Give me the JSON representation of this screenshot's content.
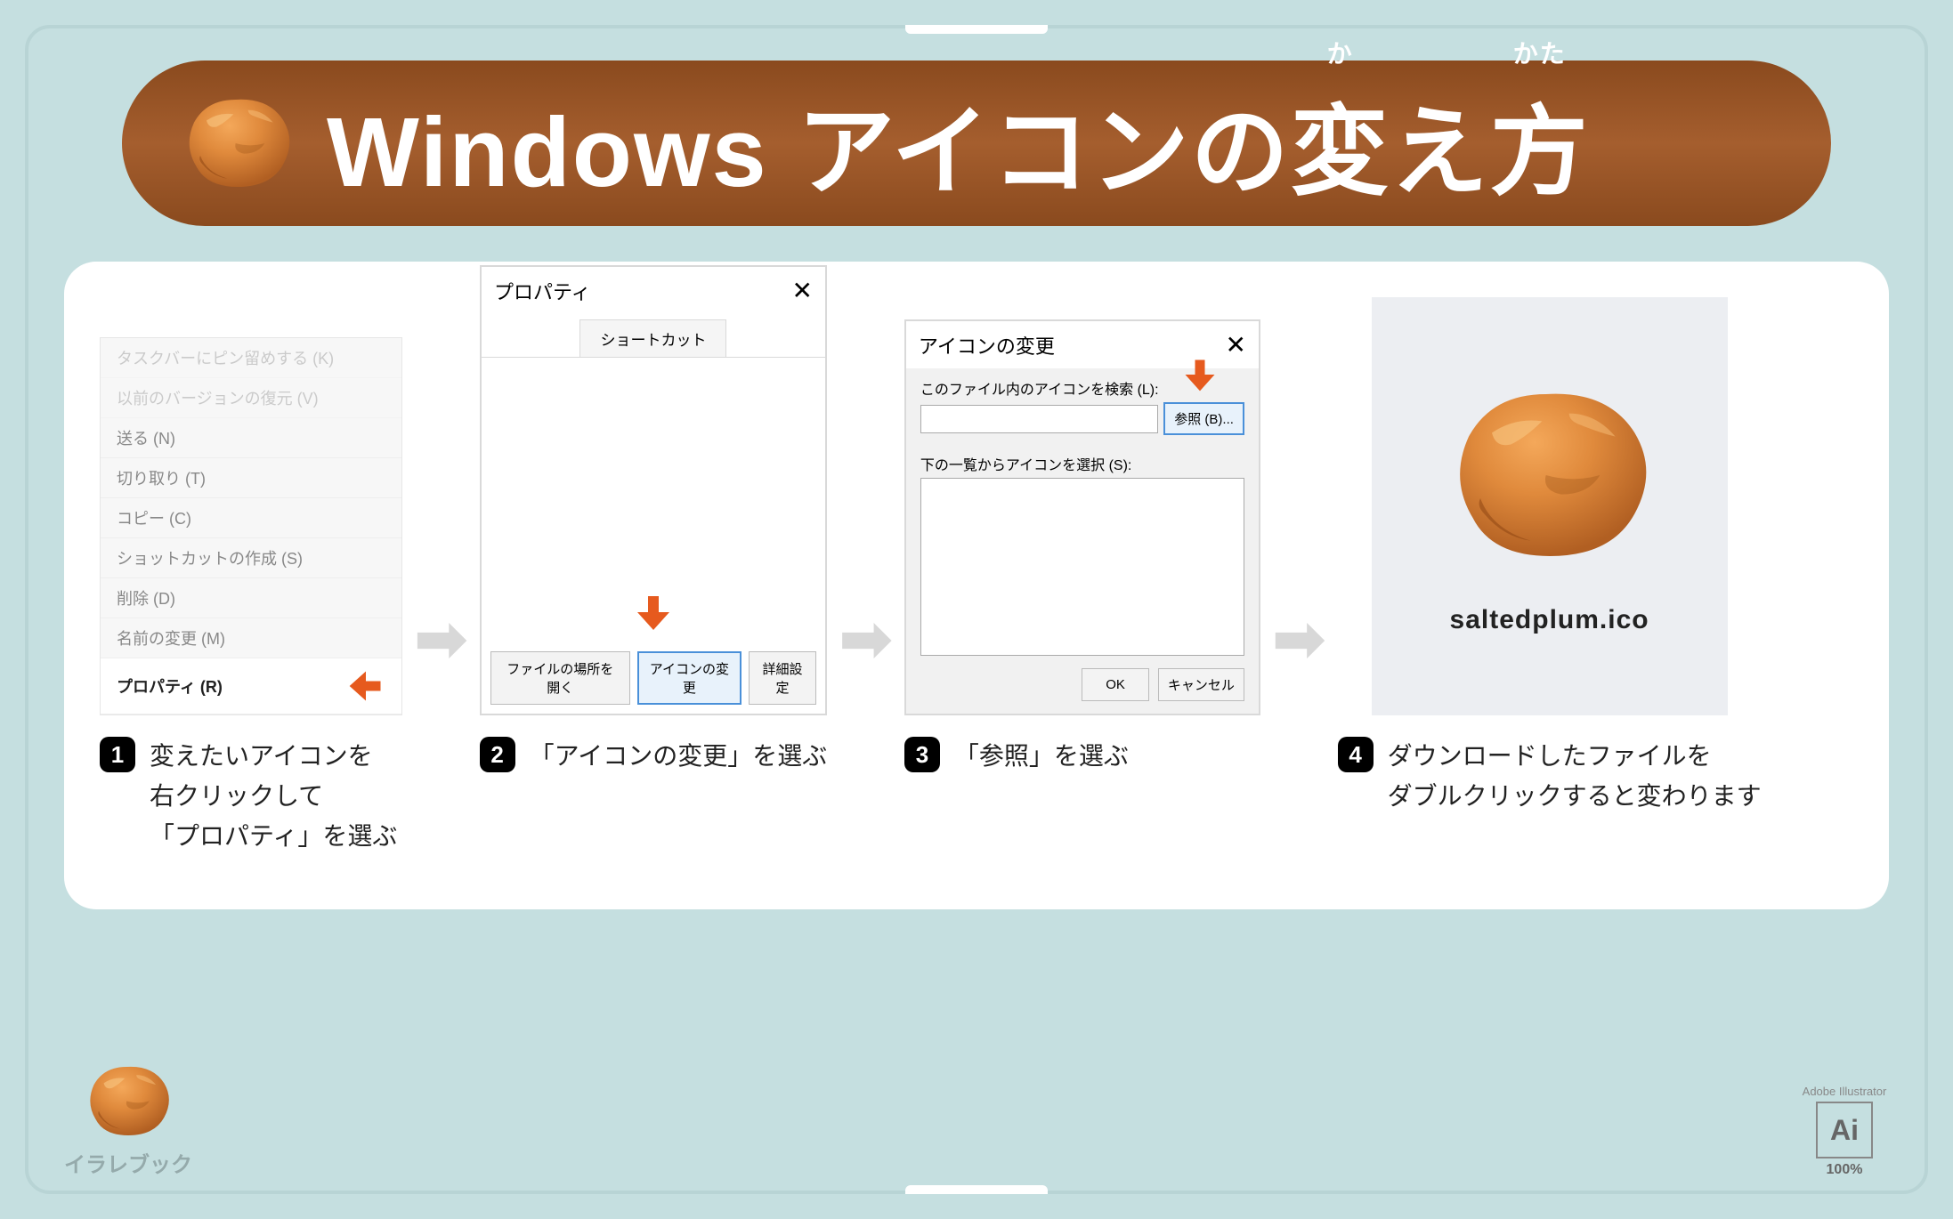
{
  "title": {
    "main": "Windows アイコンの",
    "ruby1_base": "変",
    "ruby1_top": "か",
    "mid": "え",
    "ruby2_base": "方",
    "ruby2_top": "かた"
  },
  "steps": [
    {
      "num": "1",
      "caption": "変えたいアイコンを\n右クリックして\n「プロパティ」を選ぶ",
      "context_menu": {
        "items_faded_top": [
          "タスクバーにピン留めする (K)",
          "以前のバージョンの復元 (V)"
        ],
        "items_mid": [
          "送る (N)",
          "切り取り (T)",
          "コピー (C)"
        ],
        "items_bottom": [
          "ショットカットの作成 (S)",
          "削除 (D)",
          "名前の変更 (M)"
        ],
        "active": "プロパティ (R)"
      }
    },
    {
      "num": "2",
      "caption": "「アイコンの変更」を選ぶ",
      "dialog": {
        "title": "プロパティ",
        "tab": "ショートカット",
        "buttons": {
          "open_location": "ファイルの場所を開く",
          "change_icon": "アイコンの変更",
          "advanced": "詳細設定"
        }
      }
    },
    {
      "num": "3",
      "caption": "「参照」を選ぶ",
      "dialog": {
        "title": "アイコンの変更",
        "search_label": "このファイル内のアイコンを検索 (L):",
        "browse": "参照 (B)...",
        "select_label": "下の一覧からアイコンを選択 (S):",
        "ok": "OK",
        "cancel": "キャンセル"
      }
    },
    {
      "num": "4",
      "caption": "ダウンロードしたファイルを\nダブルクリックすると変わります",
      "filename": "saltedplum.ico"
    }
  ],
  "footer": {
    "brand": "イラレブック",
    "ai_label": "Adobe Illustrator",
    "ai_text": "Ai",
    "ai_pct": "100%"
  }
}
